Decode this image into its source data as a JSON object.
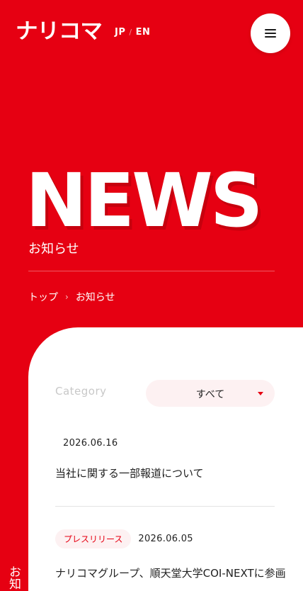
{
  "header": {
    "logo": "ナリコマ",
    "lang_jp": "JP",
    "lang_sep": "/",
    "lang_en": "EN"
  },
  "hero": {
    "title": "NEWS",
    "subtitle": "お知らせ"
  },
  "breadcrumb": {
    "home": "トップ",
    "separator": "›",
    "current": "お知らせ"
  },
  "filter": {
    "label": "Category",
    "selected": "すべて"
  },
  "news": [
    {
      "tag": "",
      "date": "2026.06.16",
      "title": "当社に関する一部報道について"
    },
    {
      "tag": "プレスリリース",
      "date": "2026.06.05",
      "title": "ナリコマグループ、順天堂大学COI-NEXTに参画"
    }
  ],
  "side_label": "お知",
  "colors": {
    "brand_red": "#e60012",
    "tag_bg": "#fdf1f2"
  }
}
